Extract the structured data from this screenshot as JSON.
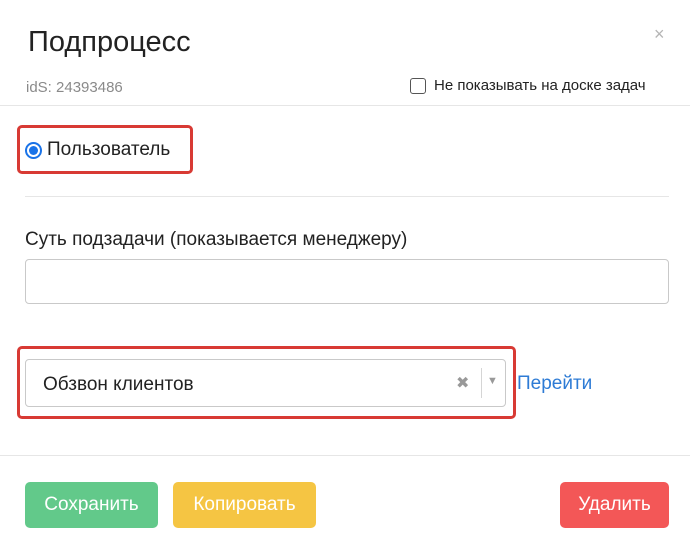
{
  "header": {
    "title": "Подпроцесс",
    "close_icon": "×",
    "ids": "idS: 24393486",
    "hide_checkbox_label": "Не показывать на доске задач",
    "hide_checked": false
  },
  "assignee": {
    "radio_label": "Пользователь",
    "selected": true
  },
  "subtask": {
    "label": "Суть подзадачи (показывается менеджеру)",
    "value": ""
  },
  "process_select": {
    "value": "Обзвон клиентов",
    "clear_icon": "✖",
    "arrow_icon": "▼",
    "link": "Перейти"
  },
  "footer": {
    "save": "Сохранить",
    "copy": "Копировать",
    "delete": "Удалить"
  },
  "colors": {
    "highlight": "#d83a34",
    "save": "#62c98a",
    "copy": "#f5c543",
    "delete": "#f35757",
    "link": "#2d7bd5"
  }
}
